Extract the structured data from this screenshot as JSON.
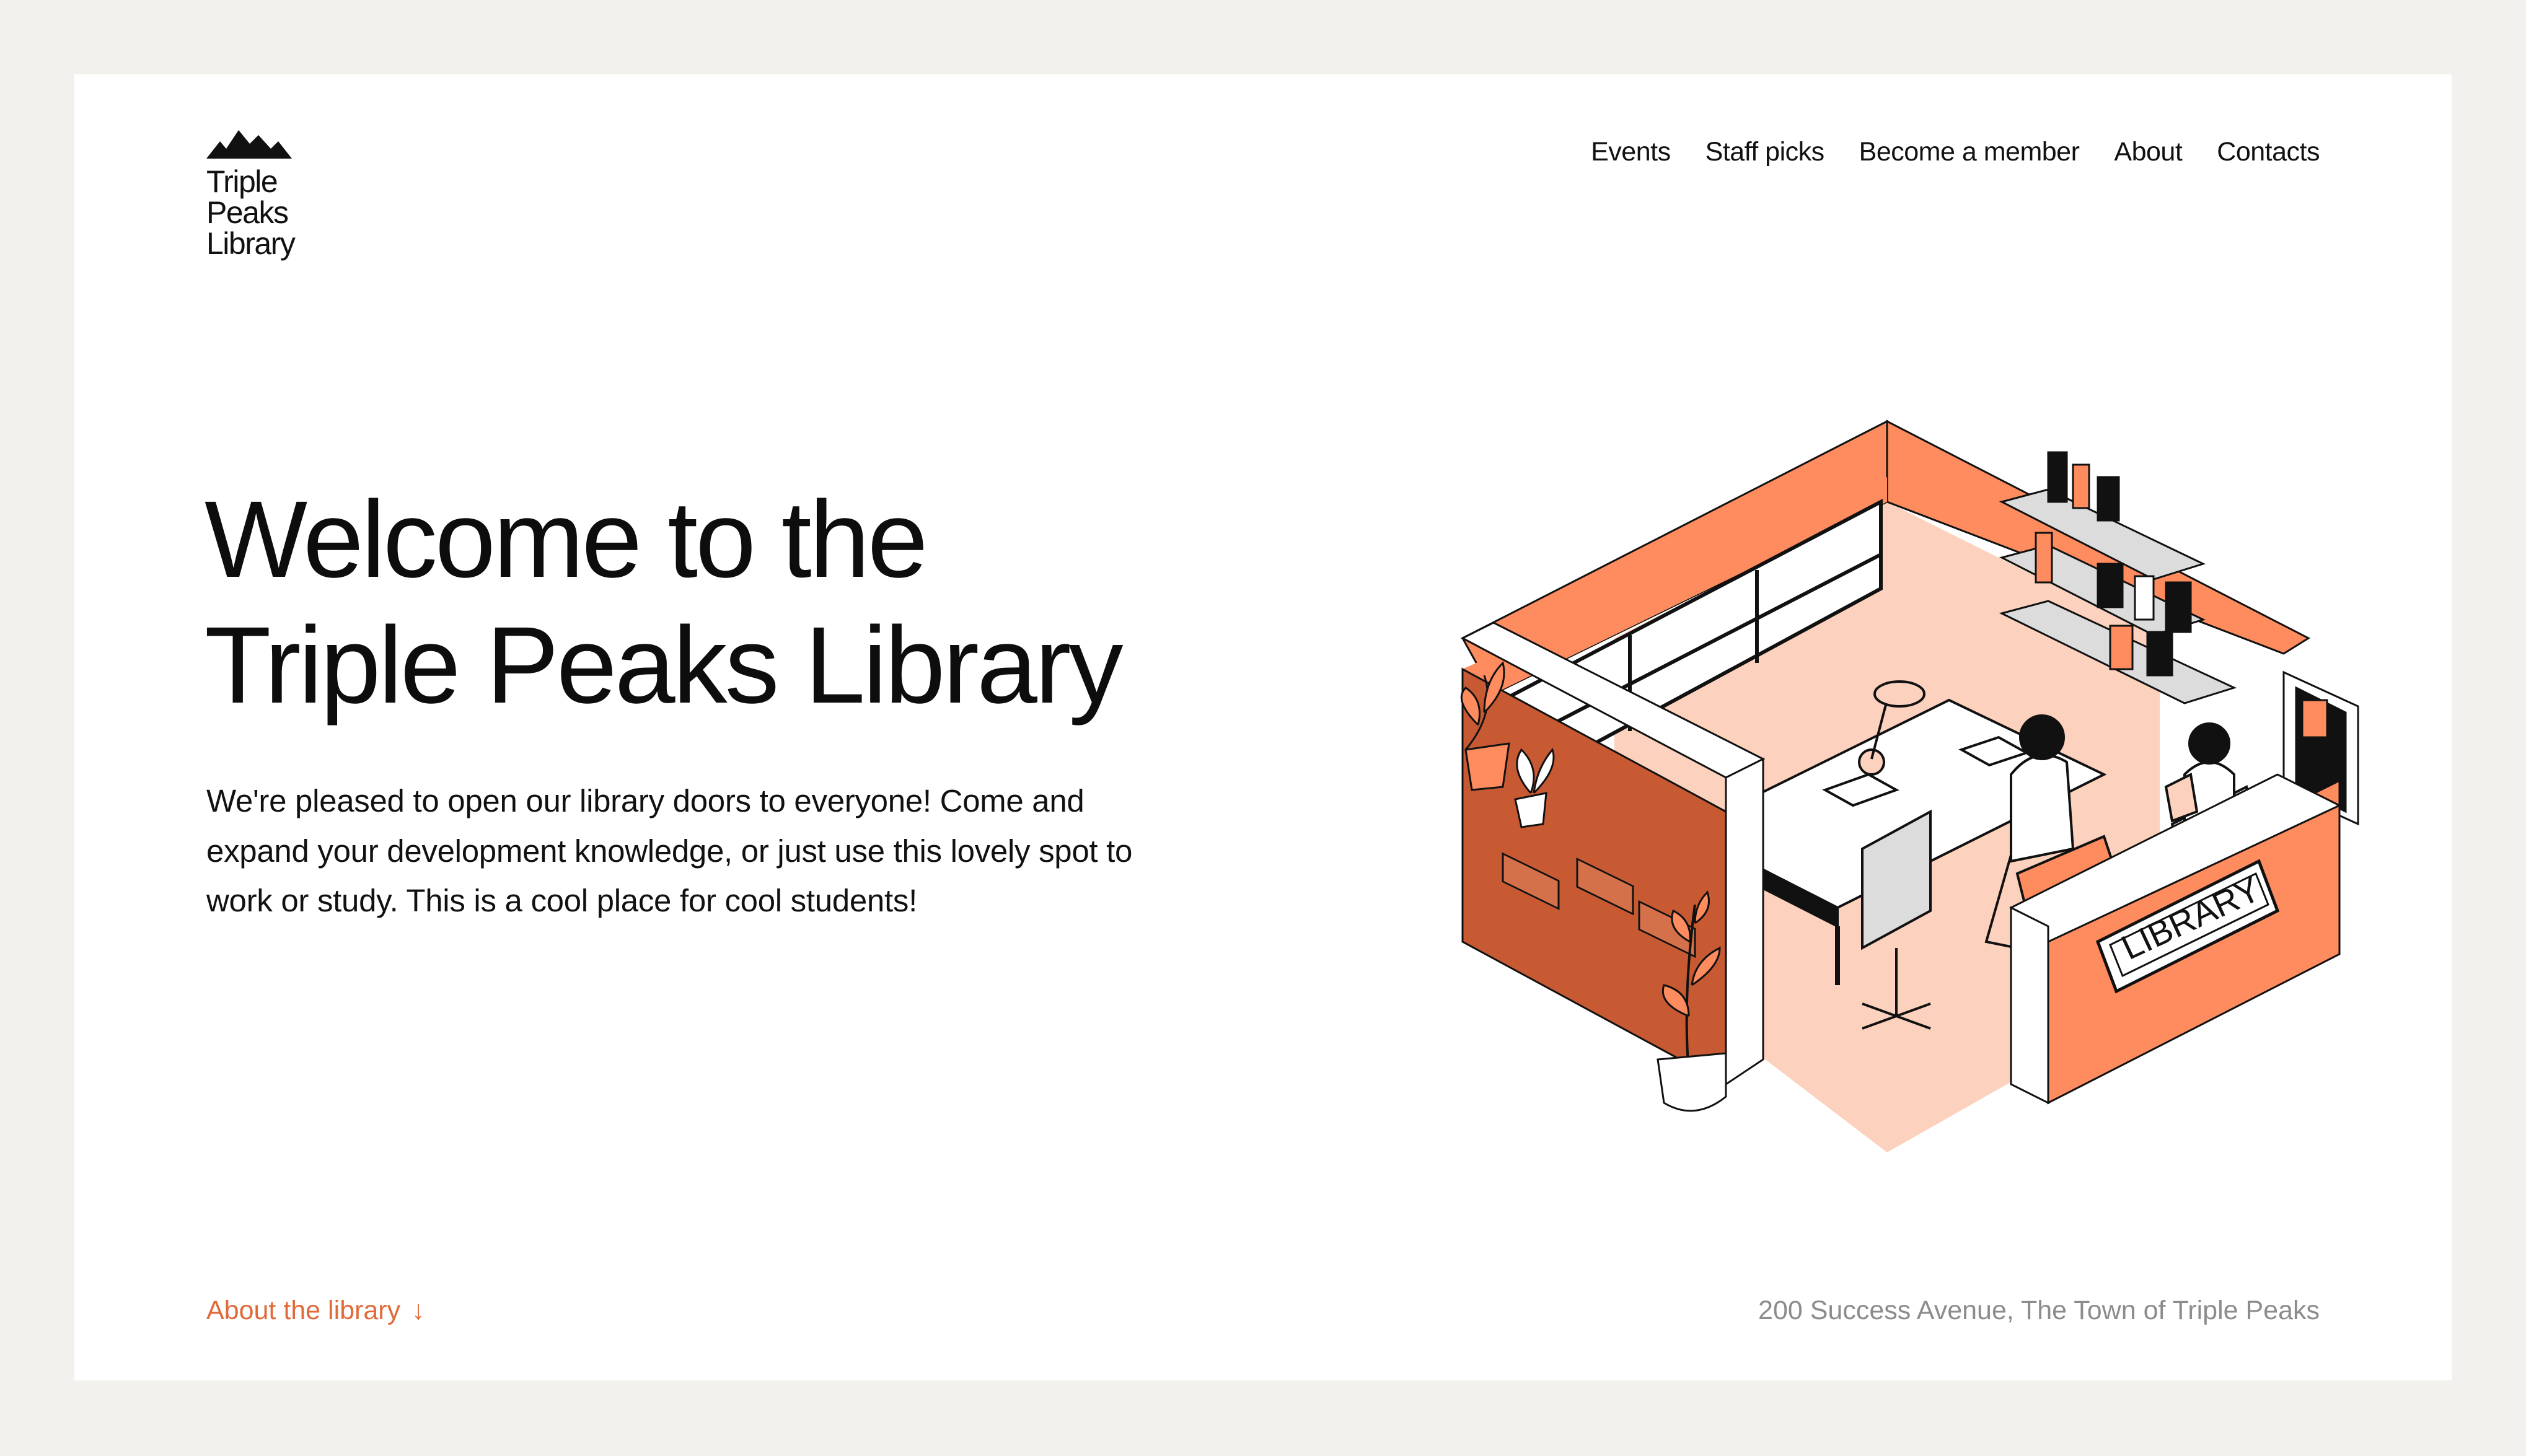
{
  "brand": {
    "name_lines": [
      "Triple",
      "Peaks",
      "Library"
    ],
    "logo_icon": "mountain-peaks-icon"
  },
  "nav": {
    "items": [
      {
        "label": "Events"
      },
      {
        "label": "Staff picks"
      },
      {
        "label": "Become a member"
      },
      {
        "label": "About"
      },
      {
        "label": "Contacts"
      }
    ]
  },
  "hero": {
    "title_lines": [
      "Welcome to the",
      "Triple Peaks Library"
    ],
    "text": "We're pleased to open our library doors to everyone! Come and expand your development knowledge, or just use this lovely spot to work or study. This is a cool place for cool students!",
    "illustration": {
      "icon": "isometric-library-room-illustration",
      "sign_text": "LIBRARY"
    }
  },
  "footer": {
    "about_link": "About the library",
    "about_arrow": "↓",
    "address": "200 Success Avenue, The Town of Triple Peaks"
  },
  "colors": {
    "accent": "#e06a38",
    "background_outer": "#f2f1ed",
    "card": "#ffffff",
    "text": "#111111",
    "muted": "#8c8c8c",
    "wall_orange": "#ff8c5e",
    "wall_dark": "#c85a33",
    "floor": "#fcd1bd"
  }
}
